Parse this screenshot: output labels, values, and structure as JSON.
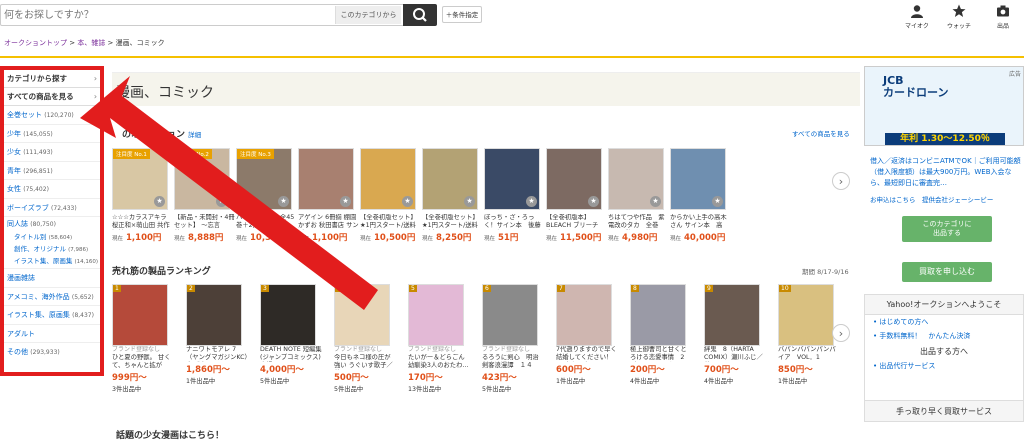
{
  "search": {
    "placeholder": "何をお探しですか？",
    "category": "このカテゴリから",
    "conditions": "＋条件指定"
  },
  "top_icons": [
    {
      "label": "マイオク"
    },
    {
      "label": "ウォッチ"
    },
    {
      "label": "出品"
    }
  ],
  "breadcrumb": {
    "home": "オークショントップ",
    "sep1": " > ",
    "parent": "本、雑誌",
    "sep2": " > ",
    "current": "漫画、コミック"
  },
  "sidebar": {
    "headers": [
      {
        "label": "カテゴリから探す"
      },
      {
        "label": "すべての商品を見る"
      }
    ],
    "items": [
      {
        "name": "全巻セット",
        "count": "(120,270)"
      },
      {
        "name": "少年",
        "count": "(145,055)"
      },
      {
        "name": "少女",
        "count": "(111,493)"
      },
      {
        "name": "青年",
        "count": "(296,851)"
      },
      {
        "name": "女性",
        "count": "(75,402)"
      },
      {
        "name": "ボーイズラブ",
        "count": "(72,433)"
      }
    ],
    "doujin": {
      "name": "同人誌",
      "count": "(80,750)"
    },
    "doujin_sub": [
      {
        "name": "タイトル別",
        "count": "(58,604)"
      },
      {
        "name": "創作、オリジナル",
        "count": "(7,986)"
      },
      {
        "name": "イラスト集、原画集",
        "count": "(14,160)"
      }
    ],
    "items2": [
      {
        "name": "漫画雑誌",
        "count": ""
      },
      {
        "name": "アメコミ、海外作品",
        "count": "(5,652)"
      },
      {
        "name": "イラスト集、原画集",
        "count": "(8,437)"
      },
      {
        "name": "アダルト",
        "count": ""
      },
      {
        "name": "その他",
        "count": "(293,933)"
      }
    ]
  },
  "main": {
    "title": "漫画、コミック",
    "auction": {
      "title": "のオークション",
      "detail": "詳細",
      "all_link": "すべての商品を見る",
      "price_label": "現在",
      "items": [
        {
          "badge": "注目度 No.1",
          "name": "☆☆☆カラスアキラ　桜正和×萌山田 共作短編…",
          "price": "1,100円"
        },
        {
          "badge": "注目度 No.2",
          "name": "【新品・未開封・4冊セット】 〜忘言義〜　…",
          "price": "8,888円"
        },
        {
          "badge": "注目度 No.3",
          "name": "ハイキュー！！全45巻＋2冊完結セット",
          "price": "10,375円"
        },
        {
          "badge": "",
          "name": "アゲイン 6冊揃 棚園かずお 秋田書店 サンデー…",
          "price": "1,100円"
        },
        {
          "badge": "",
          "name": "【全巻初版セット】★1円スタート/送料無料…",
          "price": "10,500円"
        },
        {
          "badge": "",
          "name": "【全巻初版セット】★1円スタート/送料無料…",
          "price": "8,250円"
        },
        {
          "badge": "",
          "name": "ぼっち・ざ・ろっく！サイン本　後藤ひとり…",
          "price": "51円"
        },
        {
          "badge": "",
          "name": "【全巻初版本】BLEACH ブリーチ 全…",
          "price": "11,500円"
        },
        {
          "badge": "",
          "name": "ちはてつや作品　紫電改のタカ　全巻(1〜6巻)",
          "price": "4,980円"
        },
        {
          "badge": "",
          "name": "からかい上手の高木さん サイン本　高木…",
          "price": "40,000円"
        }
      ]
    },
    "ranking": {
      "title": "売れ筋の製品ランキング",
      "period": "期間 8/17-9/16",
      "items": [
        {
          "rank": "1",
          "brand": "ブランド登録なし",
          "name": "ひと夏の野獣。 甘くて、ちゃんと拡がし…",
          "price": "999円〜",
          "count": "3件出品中"
        },
        {
          "rank": "2",
          "brand": "",
          "name": "ナニワトモアレ 7（ヤングマガジンKC）南 勝久",
          "price": "1,860円〜",
          "count": "1件出品中"
        },
        {
          "rank": "3",
          "brand": "",
          "name": "DEATH NOTE 短編集 (ジャンプコミックス) 大場つぐみ…",
          "price": "4,000円〜",
          "count": "5件出品中"
        },
        {
          "rank": "4",
          "brand": "ブランド登録なし",
          "name": "今日もネコ様の圧が強い うぐいす歌子／著",
          "price": "500円〜",
          "count": "5件出品中"
        },
        {
          "rank": "5",
          "brand": "ブランド登録なし",
          "name": "たいがー＆どらごん 幼馴染3人のおたわ…",
          "price": "170円〜",
          "count": "13件出品中"
        },
        {
          "rank": "6",
          "brand": "ブランド登録なし",
          "name": "るろうに剣心　明治剣客浪漫譚　１４（…",
          "price": "423円〜",
          "count": "5件出品中"
        },
        {
          "rank": "7",
          "brand": "",
          "name": "7代遡りますので早く結婚してください！ 3 （ビッグコミック…",
          "price": "600円〜",
          "count": "1件出品中"
        },
        {
          "rank": "8",
          "brand": "",
          "name": "極上御曹司と甘くとろける恋愛事情　2（ｍａｒｍａｌａｄｅ…",
          "price": "200円〜",
          "count": "4件出品中"
        },
        {
          "rank": "9",
          "brand": "",
          "name": "絆鬼　8（HARTA COMIX）瀬川ふじ／著",
          "price": "700円〜",
          "count": "4件出品中"
        },
        {
          "rank": "10",
          "brand": "",
          "name": "バパンバパンパンパイア　VOL．1（SHONEN CH…",
          "price": "850円〜",
          "count": "1件出品中"
        }
      ]
    },
    "shoujo_title": "話題の少女漫画はこちら！"
  },
  "right": {
    "ad_tag": "広告",
    "ad_title_1": "JCB",
    "ad_title_2": "カードローン",
    "ad_rate": "年利 1.30〜12.50％",
    "ad_text": "借入／返済はコンビニATMでOK｜ご利用可能額（借入限度額）は最大900万円。WEB入会なら、最短即日に審査完…",
    "ad_sponsor": "お申込はこちら　提供会社ジェーシービー",
    "sell_button": "このカテゴリに\n出品する",
    "buy_button": "買取を申し込む",
    "welcome_title": "Yahoo!オークションへようこそ",
    "welcome_links": [
      "はじめての方へ",
      "手数料無料！　かんたん決済"
    ],
    "seller_title": "出品する方へ",
    "seller_link": "出品代行サービス",
    "speed_title": "手っ取り早く買取サービス"
  }
}
